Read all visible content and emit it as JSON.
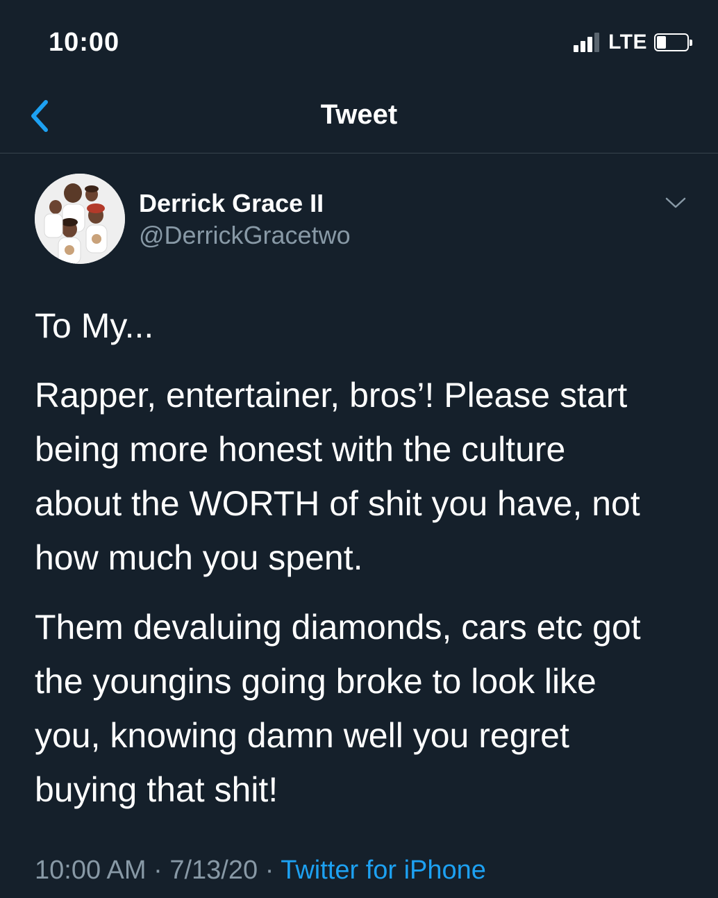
{
  "status_bar": {
    "time": "10:00",
    "carrier": "LTE",
    "signal_bars_active": 3,
    "battery_level": 0.3
  },
  "nav": {
    "title": "Tweet",
    "back_icon": "chevron-left-icon"
  },
  "author": {
    "name": "Derrick Grace II",
    "handle": "@DerrickGracetwo",
    "menu_icon": "chevron-down-icon"
  },
  "tweet": {
    "paragraphs": [
      "To My...",
      "Rapper, entertainer, bros’! Please start\nbeing more honest with the culture\nabout the WORTH of shit you have, not\nhow much you spent.",
      "Them devaluing diamonds, cars etc got\nthe youngins going broke to look like\nyou, knowing damn well you regret\nbuying that shit!"
    ],
    "time": "10:00 AM",
    "separator": " · ",
    "date": "7/13/20",
    "source": "Twitter for iPhone"
  },
  "colors": {
    "background": "#15202b",
    "text": "#ffffff",
    "secondary_text": "#8899a6",
    "accent": "#1da1f2",
    "divider": "#38444d"
  }
}
